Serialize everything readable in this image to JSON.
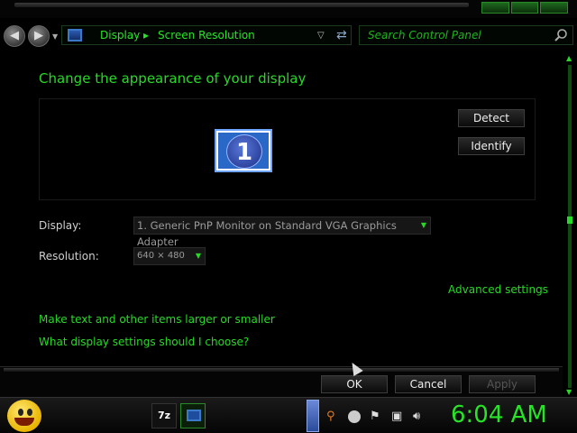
{
  "addressbar": {
    "breadcrumbs": [
      "Display",
      "Screen Resolution"
    ],
    "breadcrumb_separator": "▸",
    "search_placeholder": "Search Control Panel"
  },
  "main": {
    "title": "Change the appearance of your display",
    "monitor_number": "1",
    "detect_label": "Detect",
    "identify_label": "Identify",
    "display_label": "Display:",
    "display_value": "1. Generic PnP Monitor on Standard VGA Graphics Adapter",
    "resolution_label": "Resolution:",
    "resolution_value": "640 × 480",
    "advanced_link": "Advanced settings",
    "text_size_link": "Make text and other items larger or smaller",
    "choose_link": "What display settings should I choose?"
  },
  "footer": {
    "ok_label": "OK",
    "cancel_label": "Cancel",
    "apply_label": "Apply"
  },
  "taskbar": {
    "app_7z_label": "7z",
    "clock": "6:04 AM"
  },
  "colors": {
    "accent_green": "#27d927",
    "background": "#000000",
    "button_text": "#eeeeee"
  },
  "icons": [
    "back-icon",
    "forward-icon",
    "monitor-icon",
    "refresh-icon",
    "search-icon",
    "smiley-start-icon",
    "7zip-icon",
    "volume-icon",
    "network-icon",
    "flag-icon"
  ]
}
